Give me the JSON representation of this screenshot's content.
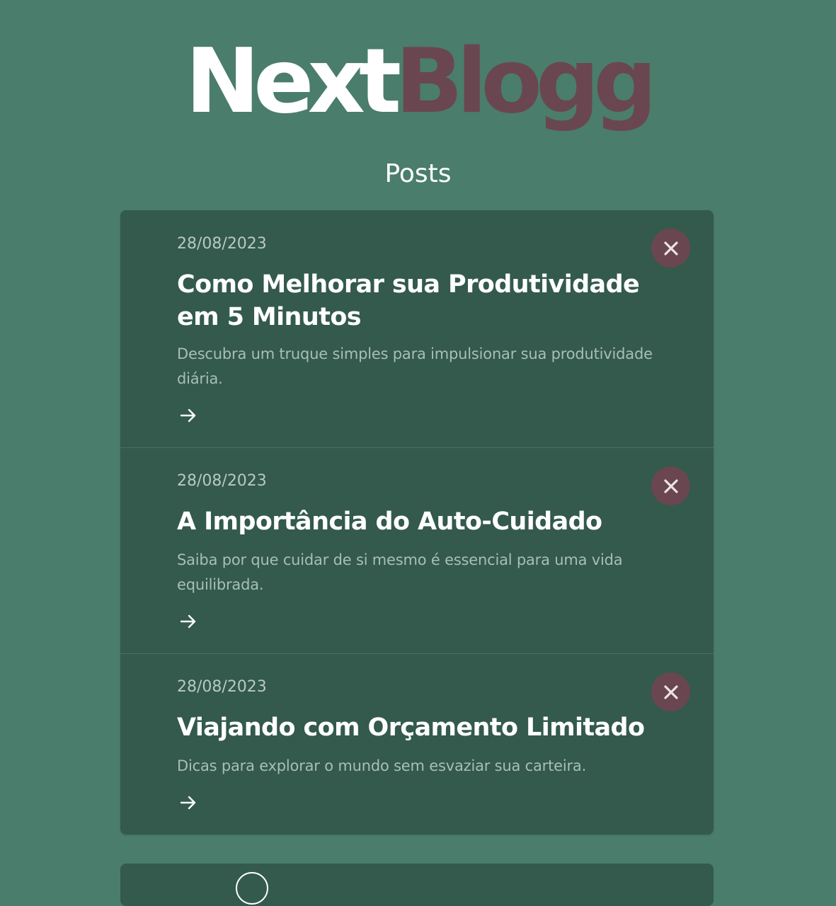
{
  "brand": {
    "logo_part1": "Next",
    "logo_part2": "Blogg",
    "color_primary": "#ffffff",
    "color_accent": "#6a4650"
  },
  "page": {
    "title": "Posts",
    "background": "#4a7d6c"
  },
  "posts": [
    {
      "date": "28/08/2023",
      "title": "Como Melhorar sua Produtividade em 5 Minutos",
      "description": "Descubra um truque simples para impulsionar sua produtividade diária.",
      "open_icon": "arrow-right-icon",
      "delete_icon": "close-icon"
    },
    {
      "date": "28/08/2023",
      "title": "A Importância do Auto-Cuidado",
      "description": "Saiba por que cuidar de si mesmo é essencial para uma vida equilibrada.",
      "open_icon": "arrow-right-icon",
      "delete_icon": "close-icon"
    },
    {
      "date": "28/08/2023",
      "title": "Viajando com Orçamento Limitado",
      "description": "Dicas para explorar o mundo sem esvaziar sua carteira.",
      "open_icon": "arrow-right-icon",
      "delete_icon": "close-icon"
    }
  ]
}
